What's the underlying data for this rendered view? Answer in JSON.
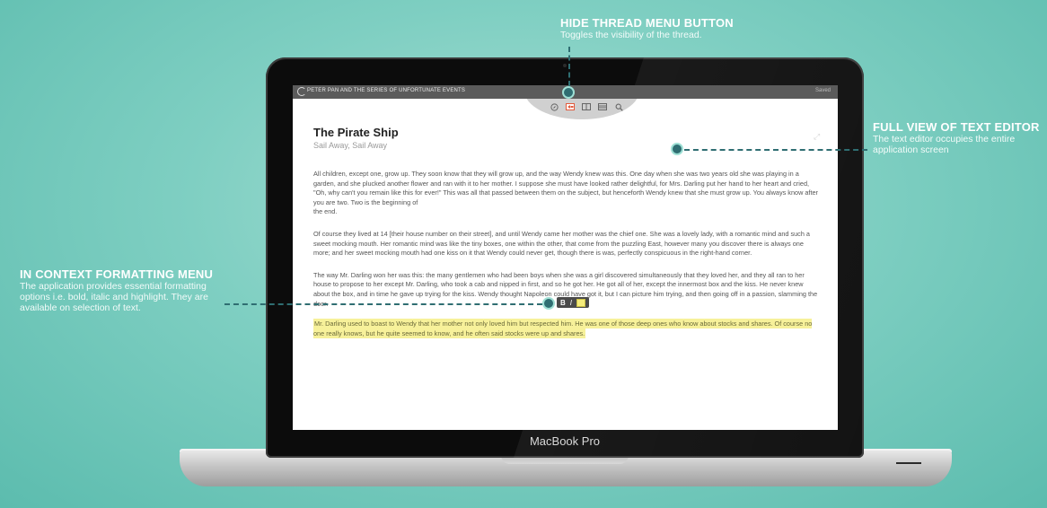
{
  "callouts": {
    "thread": {
      "title": "HIDE THREAD MENU BUTTON",
      "desc": "Toggles the visibility of the thread."
    },
    "fullview": {
      "title": "FULL VIEW OF TEXT EDITOR",
      "desc_1": "The text editor occupies the entire",
      "desc_2": "application screen"
    },
    "format": {
      "title": "IN CONTEXT FORMATTING MENU",
      "desc_1": "The application provides essential formatting",
      "desc_2": "options i.e. bold, italic and highlight. They are",
      "desc_3": "available on selection of text."
    }
  },
  "laptop": {
    "model": "MacBook Pro"
  },
  "app": {
    "topbar_title": "PETER PAN AND THE SERIES OF UNFORTUNATE EVENTS",
    "save_label": "Saved",
    "toolbar_icons": [
      "compass-icon",
      "hide-thread-icon",
      "book-icon",
      "list-icon",
      "search-icon"
    ],
    "accent": "#e25a3c"
  },
  "document": {
    "title": "The Pirate Ship",
    "subtitle": "Sail Away, Sail Away",
    "p1": "All children, except one, grow up. They soon know that they will grow up, and the way Wendy knew was this. One day when she was two years old she was playing in a garden, and she plucked another flower and ran with it to her mother. I suppose she must have looked rather delightful, for Mrs. Darling put her hand to her heart and cried, \"Oh, why can't you remain like this for ever!\" This was all that passed between them on the subject, but henceforth Wendy knew that she must grow up. You always know after you are two. Two is the beginning of",
    "p1_end": "the end.",
    "p2": "Of course they lived at 14 [their house number on their street], and until Wendy came her mother was the chief one. She was a lovely lady, with a romantic mind and such a sweet mocking mouth. Her romantic mind was like the tiny boxes, one within the other, that come from the puzzling East, however many you discover there is always one more; and her sweet mocking mouth had one kiss on it that Wendy could never get, though there is was, perfectly conspicuous in the right-hand corner.",
    "p3": "The way Mr. Darling won her was this: the many gentlemen who had been boys when she was a girl discovered simultaneously that they loved her, and they all ran to her house to propose to her except Mr. Darling, who took a cab and nipped in first, and so he got her. He got all of her, except the innermost box and the kiss. He never knew about the box, and in time he gave up trying for the kiss. Wendy thought Napoleon could have got it, but I can picture him trying, and then going off in a passion, slamming the door.",
    "p4": "Mr. Darling used to boast to Wendy that her mother not only loved him but respected him. He was one of those deep ones who know about stocks and shares. Of course no one really knows, but he quite seemed to know, and he often said stocks were up and shares."
  },
  "format_menu": {
    "bold": "B",
    "italic": "I",
    "highlight_color": "#f5ec7b"
  }
}
